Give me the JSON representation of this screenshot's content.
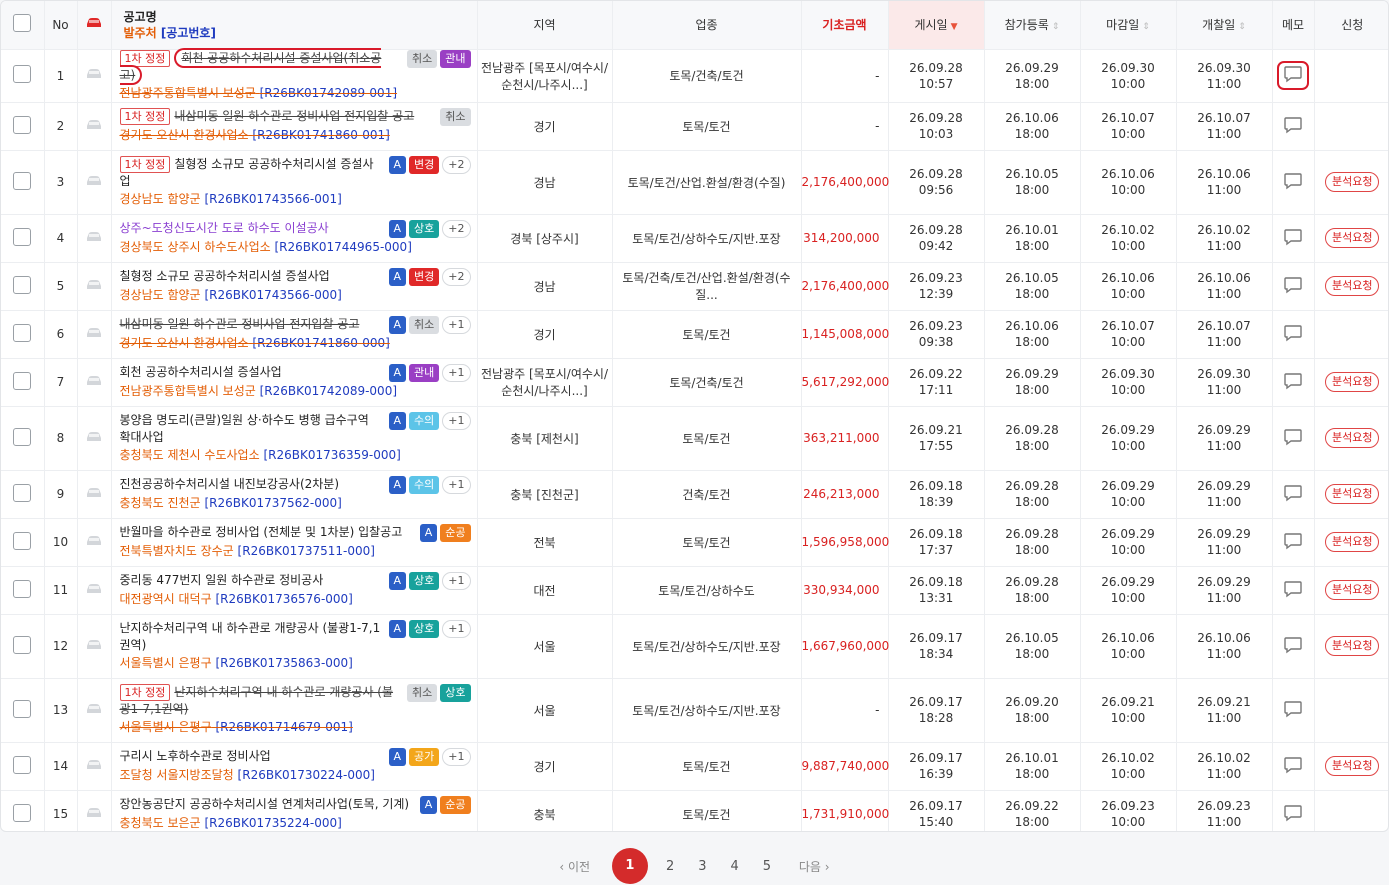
{
  "header": {
    "no": "No",
    "title_label": "공고명",
    "org_label": "발주처",
    "code_label": "[공고번호]",
    "region": "지역",
    "industry": "업종",
    "base_amount": "기초금액",
    "posted": "게시일",
    "registration": "참가등록",
    "deadline": "마감일",
    "opening": "개찰일",
    "memo": "메모",
    "apply": "신청"
  },
  "colors": {
    "accent": "#d42b2b",
    "org": "#e35d05",
    "code": "#1f3bbf"
  },
  "request_label": "분석요청",
  "rows": [
    {
      "no": "1",
      "round": "1차 정정",
      "title": "회천 공공하수처리시설 증설사업(취소공고)",
      "strike": true,
      "circled": true,
      "badges": [
        [
          "취소",
          "cancel"
        ],
        [
          "관내",
          "gov"
        ]
      ],
      "org": "전남광주통합특별시 보성군",
      "code": "[R26BK01742089-001]",
      "org_strike": true,
      "region": "전남광주 [목포시/여수시/순천시/나주시...]",
      "industry": "토목/건축/토건",
      "amount": "-",
      "posted": [
        "26.09.28",
        "10:57"
      ],
      "reg": [
        "26.09.29",
        "18:00"
      ],
      "deadline": [
        "26.09.30",
        "10:00"
      ],
      "opening": [
        "26.09.30",
        "11:00"
      ],
      "memo_circled": true,
      "request": false
    },
    {
      "no": "2",
      "round": "1차 정정",
      "title": "내삼미동 일원 하수관로 정비사업 전지입찰 공고",
      "strike": true,
      "badges": [
        [
          "취소",
          "cancel"
        ]
      ],
      "org": "경기도 오산시 환경사업소",
      "code": "[R26BK01741860-001]",
      "org_strike": true,
      "region": "경기",
      "industry": "토목/토건",
      "amount": "-",
      "posted": [
        "26.09.28",
        "10:03"
      ],
      "reg": [
        "26.10.06",
        "18:00"
      ],
      "deadline": [
        "26.10.07",
        "10:00"
      ],
      "opening": [
        "26.10.07",
        "11:00"
      ],
      "request": false
    },
    {
      "no": "3",
      "round": "1차 정정",
      "title": "칠형정 소규모 공공하수처리시설 증설사업",
      "badges": [
        [
          "A",
          "a"
        ],
        [
          "변경",
          "change"
        ],
        [
          "+2",
          "plus"
        ]
      ],
      "org": "경상남도 함양군",
      "code": "[R26BK01743566-001]",
      "region": "경남",
      "industry": "토목/토건/산업.환설/환경(수질)",
      "amount": "2,176,400,000",
      "posted": [
        "26.09.28",
        "09:56"
      ],
      "reg": [
        "26.10.05",
        "18:00"
      ],
      "deadline": [
        "26.10.06",
        "10:00"
      ],
      "opening": [
        "26.10.06",
        "11:00"
      ],
      "request": true
    },
    {
      "no": "4",
      "title": "상주~도청신도시간 도로 하수도 이설공사",
      "purple": true,
      "badges": [
        [
          "A",
          "a"
        ],
        [
          "상호",
          "sang"
        ],
        [
          "+2",
          "plus"
        ]
      ],
      "org": "경상북도 상주시 하수도사업소",
      "code": "[R26BK01744965-000]",
      "region": "경북 [상주시]",
      "industry": "토목/토건/상하수도/지반.포장",
      "amount": "314,200,000",
      "posted": [
        "26.09.28",
        "09:42"
      ],
      "reg": [
        "26.10.01",
        "18:00"
      ],
      "deadline": [
        "26.10.02",
        "10:00"
      ],
      "opening": [
        "26.10.02",
        "11:00"
      ],
      "request": true
    },
    {
      "no": "5",
      "title": "칠형정 소규모 공공하수처리시설 증설사업",
      "badges": [
        [
          "A",
          "a"
        ],
        [
          "변경",
          "change"
        ],
        [
          "+2",
          "plus"
        ]
      ],
      "org": "경상남도 함양군",
      "code": "[R26BK01743566-000]",
      "region": "경남",
      "industry": "토목/건축/토건/산업.환설/환경(수질...",
      "amount": "2,176,400,000",
      "posted": [
        "26.09.23",
        "12:39"
      ],
      "reg": [
        "26.10.05",
        "18:00"
      ],
      "deadline": [
        "26.10.06",
        "10:00"
      ],
      "opening": [
        "26.10.06",
        "11:00"
      ],
      "request": true
    },
    {
      "no": "6",
      "title": "내삼미동 일원 하수관로 정비사업 전지입찰 공고",
      "strike": true,
      "badges": [
        [
          "A",
          "a"
        ],
        [
          "취소",
          "cancel"
        ],
        [
          "+1",
          "plus"
        ]
      ],
      "org": "경기도 오산시 환경사업소",
      "code": "[R26BK01741860-000]",
      "org_strike": true,
      "region": "경기",
      "industry": "토목/토건",
      "amount": "1,145,008,000",
      "posted": [
        "26.09.23",
        "09:38"
      ],
      "reg": [
        "26.10.06",
        "18:00"
      ],
      "deadline": [
        "26.10.07",
        "10:00"
      ],
      "opening": [
        "26.10.07",
        "11:00"
      ],
      "request": false
    },
    {
      "no": "7",
      "title": "회천 공공하수처리시설 증설사업",
      "badges": [
        [
          "A",
          "a"
        ],
        [
          "관내",
          "gov"
        ],
        [
          "+1",
          "plus"
        ]
      ],
      "org": "전남광주통합특별시 보성군",
      "code": "[R26BK01742089-000]",
      "region": "전남광주 [목포시/여수시/순천시/나주시...]",
      "industry": "토목/건축/토건",
      "amount": "5,617,292,000",
      "posted": [
        "26.09.22",
        "17:11"
      ],
      "reg": [
        "26.09.29",
        "18:00"
      ],
      "deadline": [
        "26.09.30",
        "10:00"
      ],
      "opening": [
        "26.09.30",
        "11:00"
      ],
      "request": true
    },
    {
      "no": "8",
      "title": "봉양읍 명도리(큰말)일원 상·하수도 병행 급수구역 확대사업",
      "badges": [
        [
          "A",
          "a"
        ],
        [
          "수의",
          "su"
        ],
        [
          "+1",
          "plus"
        ]
      ],
      "org": "충청북도 제천시 수도사업소",
      "code": "[R26BK01736359-000]",
      "region": "충북 [제천시]",
      "industry": "토목/토건",
      "amount": "363,211,000",
      "posted": [
        "26.09.21",
        "17:55"
      ],
      "reg": [
        "26.09.28",
        "18:00"
      ],
      "deadline": [
        "26.09.29",
        "10:00"
      ],
      "opening": [
        "26.09.29",
        "11:00"
      ],
      "request": true
    },
    {
      "no": "9",
      "title": "진천공공하수처리시설 내진보강공사(2차분)",
      "badges": [
        [
          "A",
          "a"
        ],
        [
          "수의",
          "su"
        ],
        [
          "+1",
          "plus"
        ]
      ],
      "org": "충청북도 진천군",
      "code": "[R26BK01737562-000]",
      "region": "충북 [진천군]",
      "industry": "건축/토건",
      "amount": "246,213,000",
      "posted": [
        "26.09.18",
        "18:39"
      ],
      "reg": [
        "26.09.28",
        "18:00"
      ],
      "deadline": [
        "26.09.29",
        "10:00"
      ],
      "opening": [
        "26.09.29",
        "11:00"
      ],
      "request": true
    },
    {
      "no": "10",
      "title": "반월마을 하수관로 정비사업 (전체분 및 1차분) 입찰공고",
      "badges": [
        [
          "A",
          "a"
        ],
        [
          "순공",
          "sun"
        ]
      ],
      "org": "전북특별자치도 장수군",
      "code": "[R26BK01737511-000]",
      "region": "전북",
      "industry": "토목/토건",
      "amount": "1,596,958,000",
      "posted": [
        "26.09.18",
        "17:37"
      ],
      "reg": [
        "26.09.28",
        "18:00"
      ],
      "deadline": [
        "26.09.29",
        "10:00"
      ],
      "opening": [
        "26.09.29",
        "11:00"
      ],
      "request": true
    },
    {
      "no": "11",
      "title": "중리동 477번지 일원 하수관로 정비공사",
      "badges": [
        [
          "A",
          "a"
        ],
        [
          "상호",
          "sang"
        ],
        [
          "+1",
          "plus"
        ]
      ],
      "org": "대전광역시 대덕구",
      "code": "[R26BK01736576-000]",
      "region": "대전",
      "industry": "토목/토건/상하수도",
      "amount": "330,934,000",
      "posted": [
        "26.09.18",
        "13:31"
      ],
      "reg": [
        "26.09.28",
        "18:00"
      ],
      "deadline": [
        "26.09.29",
        "10:00"
      ],
      "opening": [
        "26.09.29",
        "11:00"
      ],
      "request": true
    },
    {
      "no": "12",
      "title": "난지하수처리구역 내 하수관로 개량공사 (불광1-7,1권역)",
      "badges": [
        [
          "A",
          "a"
        ],
        [
          "상호",
          "sang"
        ],
        [
          "+1",
          "plus"
        ]
      ],
      "org": "서울특별시 은평구",
      "code": "[R26BK01735863-000]",
      "region": "서울",
      "industry": "토목/토건/상하수도/지반.포장",
      "amount": "1,667,960,000",
      "posted": [
        "26.09.17",
        "18:34"
      ],
      "reg": [
        "26.10.05",
        "18:00"
      ],
      "deadline": [
        "26.10.06",
        "10:00"
      ],
      "opening": [
        "26.10.06",
        "11:00"
      ],
      "request": true
    },
    {
      "no": "13",
      "round": "1차 정정",
      "title": "난지하수처리구역 내 하수관로 개량공사 (불광1-7,1권역)",
      "strike": true,
      "badges": [
        [
          "취소",
          "cancel"
        ],
        [
          "상호",
          "sang"
        ]
      ],
      "org": "서울특별시 은평구",
      "code": "[R26BK01714679-001]",
      "org_strike": true,
      "region": "서울",
      "industry": "토목/토건/상하수도/지반.포장",
      "amount": "-",
      "posted": [
        "26.09.17",
        "18:28"
      ],
      "reg": [
        "26.09.20",
        "18:00"
      ],
      "deadline": [
        "26.09.21",
        "10:00"
      ],
      "opening": [
        "26.09.21",
        "11:00"
      ],
      "request": false
    },
    {
      "no": "14",
      "title": "구리시 노후하수관로 정비사업",
      "badges": [
        [
          "A",
          "a"
        ],
        [
          "공가",
          "gong"
        ],
        [
          "+1",
          "plus"
        ]
      ],
      "org": "조달청 서울지방조달청",
      "code": "[R26BK01730224-000]",
      "region": "경기",
      "industry": "토목/토건",
      "amount": "9,887,740,000",
      "posted": [
        "26.09.17",
        "16:39"
      ],
      "reg": [
        "26.10.01",
        "18:00"
      ],
      "deadline": [
        "26.10.02",
        "10:00"
      ],
      "opening": [
        "26.10.02",
        "11:00"
      ],
      "request": true
    },
    {
      "no": "15",
      "title": "장안농공단지 공공하수처리시설 연계처리사업(토목, 기계)",
      "badges": [
        [
          "A",
          "a"
        ],
        [
          "순공",
          "sun"
        ]
      ],
      "org": "충청북도 보은군",
      "code": "[R26BK01735224-000]",
      "region": "충북",
      "industry": "토목/토건",
      "amount": "1,731,910,000",
      "posted": [
        "26.09.17",
        "15:40"
      ],
      "reg": [
        "26.09.22",
        "18:00"
      ],
      "deadline": [
        "26.09.23",
        "10:00"
      ],
      "opening": [
        "26.09.23",
        "11:00"
      ],
      "request": false
    }
  ],
  "pagination": {
    "prev": "‹ 이전",
    "pages": [
      "1",
      "2",
      "3",
      "4",
      "5"
    ],
    "current": "1",
    "next": "다음 ›"
  }
}
